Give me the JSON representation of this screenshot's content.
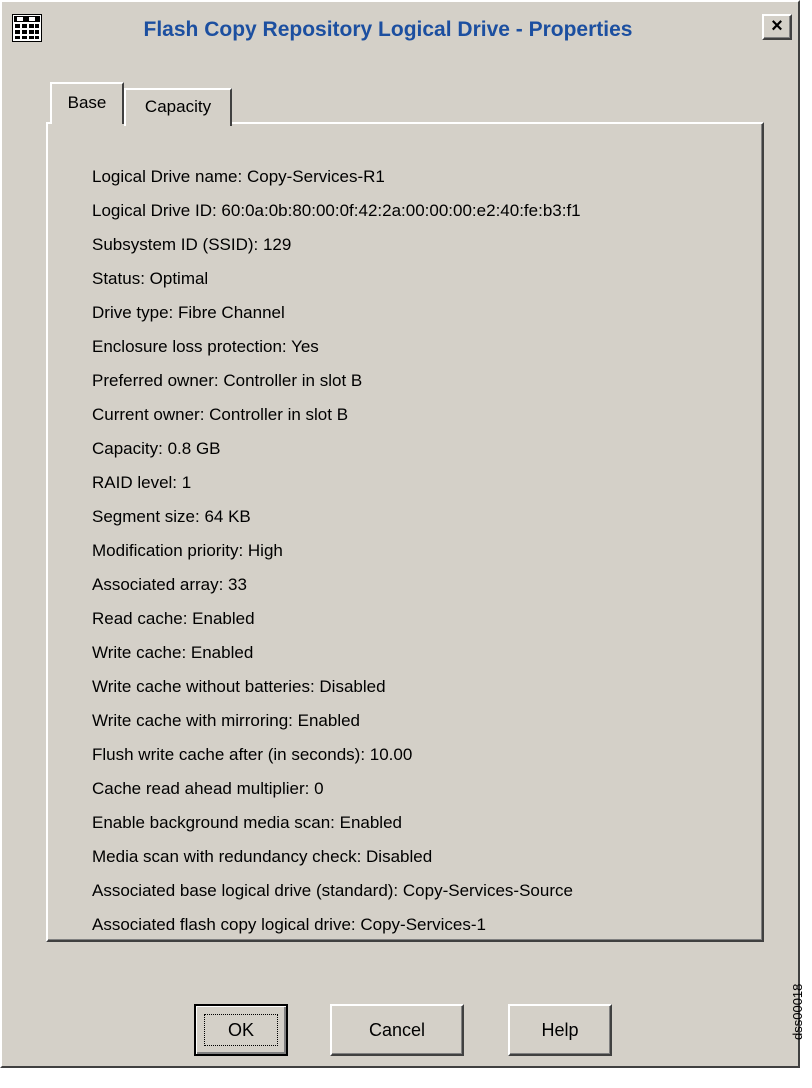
{
  "window": {
    "title": "Flash Copy Repository Logical Drive - Properties",
    "close_glyph": "×"
  },
  "tabs": [
    {
      "label": "Base",
      "selected": true
    },
    {
      "label": "Capacity",
      "selected": false
    }
  ],
  "properties": [
    "Logical Drive name: Copy-Services-R1",
    "Logical Drive ID: 60:0a:0b:80:00:0f:42:2a:00:00:00:e2:40:fe:b3:f1",
    "Subsystem ID (SSID): 129",
    "Status: Optimal",
    "Drive type: Fibre Channel",
    "Enclosure loss protection: Yes",
    "Preferred owner: Controller in slot B",
    "Current owner: Controller in slot B",
    "Capacity: 0.8 GB",
    "RAID level: 1",
    "Segment size: 64 KB",
    "Modification priority: High",
    "Associated array: 33",
    "Read cache: Enabled",
    "Write cache: Enabled",
    "Write cache without batteries: Disabled",
    "Write cache with mirroring: Enabled",
    "Flush write cache after (in seconds): 10.00",
    "Cache read ahead multiplier: 0",
    "Enable background media scan: Enabled",
    "Media scan with redundancy check: Disabled",
    "Associated base logical drive (standard): Copy-Services-Source",
    "Associated flash copy logical drive: Copy-Services-1"
  ],
  "buttons": {
    "ok": "OK",
    "cancel": "Cancel",
    "help": "Help"
  },
  "figure_id": "dss00018",
  "colors": {
    "title_text": "#1c4fa0",
    "dialog_bg": "#d4d0c8"
  },
  "icons": {
    "title": "grid-app-icon",
    "close": "close-icon"
  }
}
